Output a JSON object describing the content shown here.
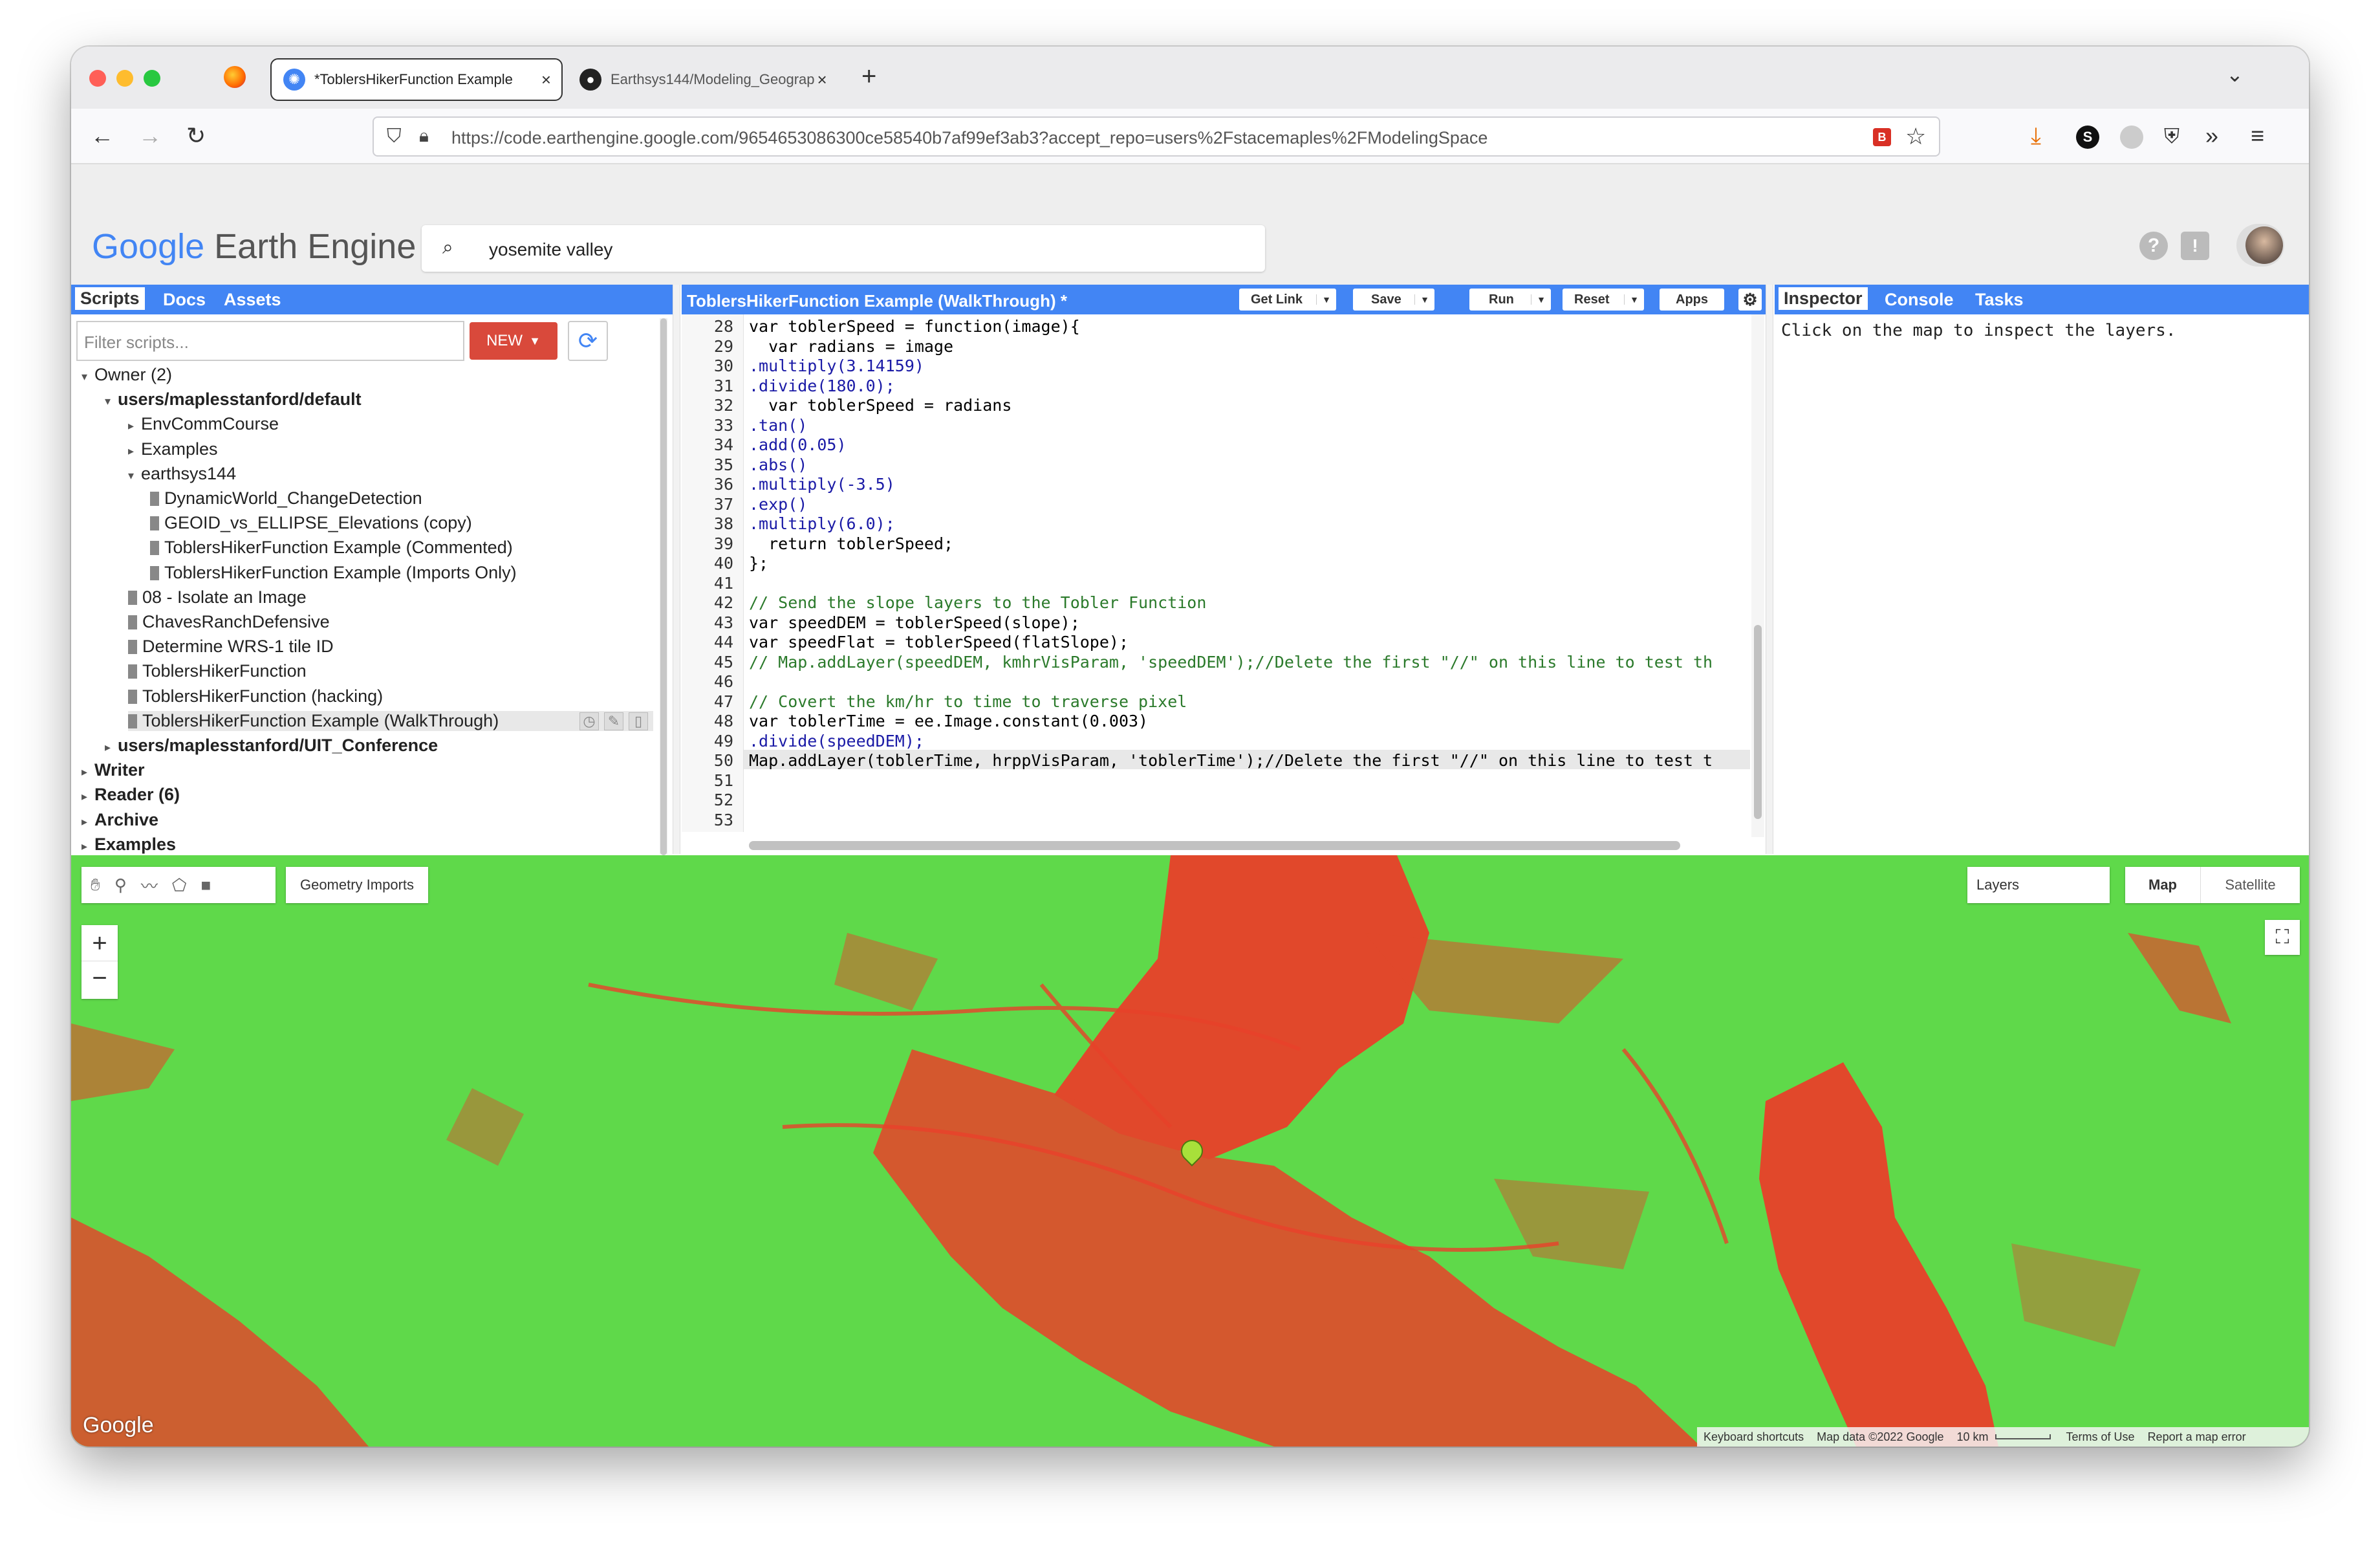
{
  "browser": {
    "tabs": [
      {
        "title": "*ToblersHikerFunction Example",
        "icon": "earth-engine-icon",
        "active": true
      },
      {
        "title": "Earthsys144/Modeling_Geograp",
        "icon": "github-icon",
        "active": false
      }
    ],
    "new_tab": "+",
    "url": "https://code.earthengine.google.com/9654653086300ce58540b7af99ef3ab3?accept_repo=users%2Fstacemaples%2FModelingSpace"
  },
  "header": {
    "logo_google": "Google",
    "logo_product": "Earth Engine",
    "search_value": "yosemite valley"
  },
  "left_panel": {
    "tabs": [
      "Scripts",
      "Docs",
      "Assets"
    ],
    "filter_placeholder": "Filter scripts...",
    "new_button": "NEW",
    "tree": [
      {
        "label": "Owner (2)",
        "bold": false,
        "level": 0,
        "kind": "folder-open"
      },
      {
        "label": "users/maplesstanford/default",
        "bold": true,
        "level": 1,
        "kind": "folder-open"
      },
      {
        "label": "EnvCommCourse",
        "bold": false,
        "level": 2,
        "kind": "folder"
      },
      {
        "label": "Examples",
        "bold": false,
        "level": 2,
        "kind": "folder"
      },
      {
        "label": "earthsys144",
        "bold": false,
        "level": 2,
        "kind": "folder-open"
      },
      {
        "label": "DynamicWorld_ChangeDetection",
        "bold": false,
        "level": 3,
        "kind": "file"
      },
      {
        "label": "GEOID_vs_ELLIPSE_Elevations (copy)",
        "bold": false,
        "level": 3,
        "kind": "file"
      },
      {
        "label": "ToblersHikerFunction Example (Commented)",
        "bold": false,
        "level": 3,
        "kind": "file"
      },
      {
        "label": "ToblersHikerFunction Example (Imports Only)",
        "bold": false,
        "level": 3,
        "kind": "file"
      },
      {
        "label": "08 - Isolate an Image",
        "bold": false,
        "level": 2,
        "kind": "file"
      },
      {
        "label": "ChavesRanchDefensive",
        "bold": false,
        "level": 2,
        "kind": "file"
      },
      {
        "label": "Determine WRS-1 tile ID",
        "bold": false,
        "level": 2,
        "kind": "file"
      },
      {
        "label": "ToblersHikerFunction",
        "bold": false,
        "level": 2,
        "kind": "file"
      },
      {
        "label": "ToblersHikerFunction (hacking)",
        "bold": false,
        "level": 2,
        "kind": "file"
      },
      {
        "label": "ToblersHikerFunction Example (WalkThrough)",
        "bold": false,
        "level": 2,
        "kind": "file-selected"
      },
      {
        "label": "users/maplesstanford/UIT_Conference",
        "bold": true,
        "level": 1,
        "kind": "folder"
      },
      {
        "label": "Writer",
        "bold": true,
        "level": 0,
        "kind": "folder"
      },
      {
        "label": "Reader (6)",
        "bold": true,
        "level": 0,
        "kind": "folder"
      },
      {
        "label": "Archive",
        "bold": true,
        "level": 0,
        "kind": "folder"
      },
      {
        "label": "Examples",
        "bold": true,
        "level": 0,
        "kind": "folder"
      }
    ]
  },
  "editor": {
    "title": "ToblersHikerFunction Example (WalkThrough) *",
    "buttons": {
      "get_link": "Get Link",
      "save": "Save",
      "run": "Run",
      "reset": "Reset",
      "apps": "Apps"
    },
    "lines": [
      {
        "n": "28",
        "code": "var toblerSpeed = function(image){"
      },
      {
        "n": "29",
        "code": "  var radians = image"
      },
      {
        "n": "30",
        "code": ".multiply(3.14159)"
      },
      {
        "n": "31",
        "code": ".divide(180.0);"
      },
      {
        "n": "32",
        "code": "  var toblerSpeed = radians"
      },
      {
        "n": "33",
        "code": ".tan()"
      },
      {
        "n": "34",
        "code": ".add(0.05)"
      },
      {
        "n": "35",
        "code": ".abs()"
      },
      {
        "n": "36",
        "code": ".multiply(-3.5)"
      },
      {
        "n": "37",
        "code": ".exp()"
      },
      {
        "n": "38",
        "code": ".multiply(6.0);"
      },
      {
        "n": "39",
        "code": "  return toblerSpeed;"
      },
      {
        "n": "40",
        "code": "};"
      },
      {
        "n": "41",
        "code": ""
      },
      {
        "n": "42",
        "code": "// Send the slope layers to the Tobler Function"
      },
      {
        "n": "43",
        "code": "var speedDEM = toblerSpeed(slope);"
      },
      {
        "n": "44",
        "code": "var speedFlat = toblerSpeed(flatSlope);"
      },
      {
        "n": "45",
        "code": "// Map.addLayer(speedDEM, kmhrVisParam, 'speedDEM');//Delete the first \"//\" on this line to test th"
      },
      {
        "n": "46",
        "code": ""
      },
      {
        "n": "47",
        "code": "// Covert the km/hr to time to traverse pixel"
      },
      {
        "n": "48",
        "code": "var toblerTime = ee.Image.constant(0.003)"
      },
      {
        "n": "49",
        "code": ".divide(speedDEM);"
      },
      {
        "n": "50",
        "code": "Map.addLayer(toblerTime, hrppVisParam, 'toblerTime');//Delete the first \"//\" on this line to test t"
      },
      {
        "n": "51",
        "code": ""
      },
      {
        "n": "52",
        "code": ""
      },
      {
        "n": "53",
        "code": ""
      }
    ]
  },
  "right_panel": {
    "tabs": [
      "Inspector",
      "Console",
      "Tasks"
    ],
    "message": "Click on the map to inspect the layers."
  },
  "map": {
    "geometry_imports": "Geometry Imports",
    "zoom_in": "+",
    "zoom_out": "−",
    "layers": "Layers",
    "map_type": "Map",
    "satellite_type": "Satellite",
    "google_watermark": "Google",
    "footer": {
      "shortcuts": "Keyboard shortcuts",
      "map_data": "Map data ©2022 Google",
      "scale": "10 km",
      "terms": "Terms of Use",
      "report": "Report a map error"
    },
    "colors": {
      "low_cost": "#5fd94a",
      "high_cost": "#e8412a"
    }
  }
}
